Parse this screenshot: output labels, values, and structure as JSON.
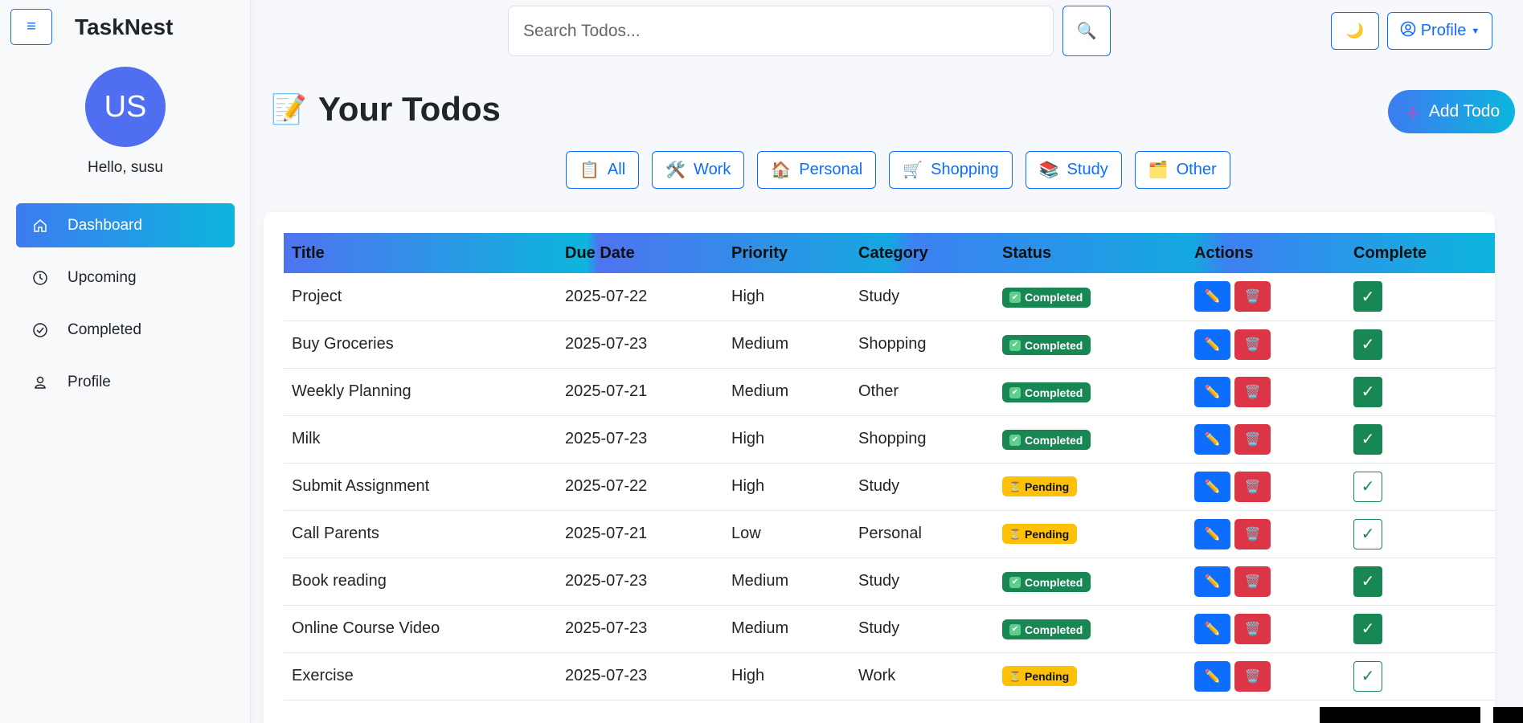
{
  "sidebar": {
    "brand": "TaskNest",
    "avatar_initials": "US",
    "greeting": "Hello, susu",
    "items": [
      {
        "label": "Dashboard",
        "icon": "home-icon",
        "active": true
      },
      {
        "label": "Upcoming",
        "icon": "clock-icon"
      },
      {
        "label": "Completed",
        "icon": "check-circle-icon"
      },
      {
        "label": "Profile",
        "icon": "user-icon"
      }
    ]
  },
  "topbar": {
    "search_placeholder": "Search Todos...",
    "profile_label": "Profile"
  },
  "main": {
    "emoji": "📝",
    "title": "Your Todos",
    "add_label": "Add Todo",
    "filters": [
      {
        "emoji": "📋",
        "label": "All"
      },
      {
        "emoji": "🛠️",
        "label": "Work"
      },
      {
        "emoji": "🏠",
        "label": "Personal"
      },
      {
        "emoji": "🛒",
        "label": "Shopping"
      },
      {
        "emoji": "📚",
        "label": "Study"
      },
      {
        "emoji": "🗂️",
        "label": "Other"
      }
    ]
  },
  "table": {
    "headers": [
      "Title",
      "Due Date",
      "Priority",
      "Category",
      "Status",
      "Actions",
      "Complete"
    ],
    "rows": [
      {
        "title": "Project",
        "due": "2025-07-22",
        "priority": "High",
        "category": "Study",
        "status": "Completed"
      },
      {
        "title": "Buy Groceries",
        "due": "2025-07-23",
        "priority": "Medium",
        "category": "Shopping",
        "status": "Completed"
      },
      {
        "title": "Weekly Planning",
        "due": "2025-07-21",
        "priority": "Medium",
        "category": "Other",
        "status": "Completed"
      },
      {
        "title": "Milk",
        "due": "2025-07-23",
        "priority": "High",
        "category": "Shopping",
        "status": "Completed"
      },
      {
        "title": "Submit Assignment",
        "due": "2025-07-22",
        "priority": "High",
        "category": "Study",
        "status": "Pending"
      },
      {
        "title": "Call Parents",
        "due": "2025-07-21",
        "priority": "Low",
        "category": "Personal",
        "status": "Pending"
      },
      {
        "title": "Book reading",
        "due": "2025-07-23",
        "priority": "Medium",
        "category": "Study",
        "status": "Completed"
      },
      {
        "title": "Online Course Video",
        "due": "2025-07-23",
        "priority": "Medium",
        "category": "Study",
        "status": "Completed"
      },
      {
        "title": "Exercise",
        "due": "2025-07-23",
        "priority": "High",
        "category": "Work",
        "status": "Pending"
      }
    ]
  },
  "colors": {
    "primary": "#0d6efd",
    "success": "#198754",
    "warning": "#ffc107",
    "danger": "#dc3545",
    "avatar": "#4f6ef0"
  }
}
